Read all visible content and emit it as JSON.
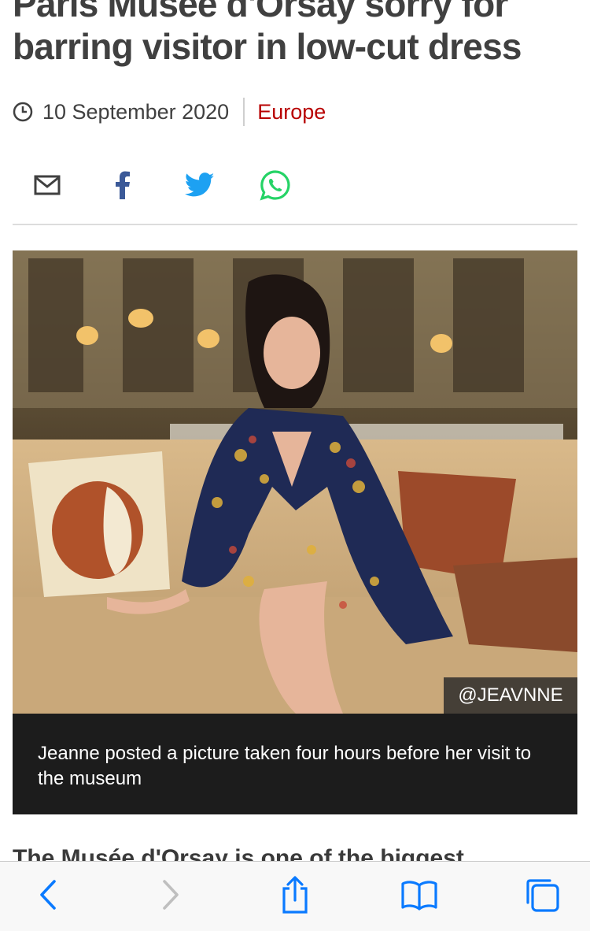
{
  "article": {
    "headline": "Paris Musée d'Orsay sorry for barring visitor in low-cut dress",
    "date": "10 September 2020",
    "section": "Europe"
  },
  "share": {
    "icons": [
      "email-icon",
      "facebook-icon",
      "twitter-icon",
      "whatsapp-icon"
    ],
    "colors": {
      "twitter": "#1da1f2",
      "whatsapp": "#25d366",
      "facebook": "#3b5998",
      "email": "#404040"
    }
  },
  "photo": {
    "credit": "@JEAVNNE",
    "caption": "Jeanne posted a picture taken four hours before her visit to the museum"
  },
  "body": {
    "first_line": "The Musée d'Orsay is one of the biggest"
  },
  "colors": {
    "section": "#b80000",
    "safari_tint": "#0a7aff"
  },
  "safari_toolbar": {
    "icons": [
      "back-icon",
      "forward-icon",
      "share-icon",
      "bookmarks-icon",
      "tabs-icon"
    ]
  }
}
